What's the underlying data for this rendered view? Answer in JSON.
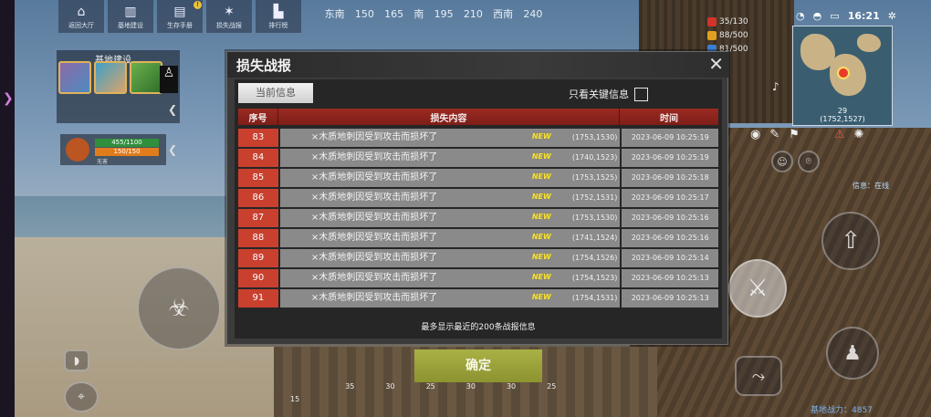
{
  "top_menu": [
    {
      "label": "返回大厅",
      "icon": "home-icon"
    },
    {
      "label": "基地建设",
      "icon": "building-icon"
    },
    {
      "label": "生存手册",
      "icon": "book-icon",
      "badge": "!"
    },
    {
      "label": "损失战报",
      "icon": "battle-icon"
    },
    {
      "label": "排行榜",
      "icon": "ranking-icon"
    }
  ],
  "compass": [
    "东南",
    "150",
    "165",
    "南",
    "195",
    "210",
    "西南",
    "240"
  ],
  "stats": [
    {
      "value": "35/130",
      "color": "#d2332a"
    },
    {
      "value": "88/500",
      "color": "#e0a020"
    },
    {
      "value": "81/500",
      "color": "#3a7fd0"
    }
  ],
  "clock": {
    "time": "16:21"
  },
  "minimap": {
    "marker_id": "29",
    "coord": "(1752,1527)"
  },
  "base_panel": {
    "title": "基地建设"
  },
  "hp_panel": {
    "bar1": "455/1100",
    "bar2": "150/150",
    "label": "无害"
  },
  "dialog": {
    "title": "损失战报",
    "tab_current": "当前信息",
    "key_filter_label": "只看关键信息",
    "columns": [
      "序号",
      "损失内容",
      "时间"
    ],
    "rows": [
      {
        "no": "83",
        "content": "×木质地刺因受到攻击而损坏了",
        "tag": "NEW",
        "coord": "(1753,1530)",
        "time": "2023-06-09 10:25:19"
      },
      {
        "no": "84",
        "content": "×木质地刺因受到攻击而损坏了",
        "tag": "NEW",
        "coord": "(1740,1523)",
        "time": "2023-06-09 10:25:19"
      },
      {
        "no": "85",
        "content": "×木质地刺因受到攻击而损坏了",
        "tag": "NEW",
        "coord": "(1753,1525)",
        "time": "2023-06-09 10:25:18"
      },
      {
        "no": "86",
        "content": "×木质地刺因受到攻击而损坏了",
        "tag": "NEW",
        "coord": "(1752,1531)",
        "time": "2023-06-09 10:25:17"
      },
      {
        "no": "87",
        "content": "×木质地刺因受到攻击而损坏了",
        "tag": "NEW",
        "coord": "(1753,1530)",
        "time": "2023-06-09 10:25:16"
      },
      {
        "no": "88",
        "content": "×木质地刺因受到攻击而损坏了",
        "tag": "NEW",
        "coord": "(1741,1524)",
        "time": "2023-06-09 10:25:16"
      },
      {
        "no": "89",
        "content": "×木质地刺因受到攻击而损坏了",
        "tag": "NEW",
        "coord": "(1754,1526)",
        "time": "2023-06-09 10:25:14"
      },
      {
        "no": "90",
        "content": "×木质地刺因受到攻击而损坏了",
        "tag": "NEW",
        "coord": "(1754,1523)",
        "time": "2023-06-09 10:25:13"
      },
      {
        "no": "91",
        "content": "×木质地刺因受到攻击而损坏了",
        "tag": "NEW",
        "coord": "(1754,1531)",
        "time": "2023-06-09 10:25:13"
      }
    ],
    "footer_note": "最多显示最近的200条战报信息",
    "confirm_label": "确定"
  },
  "bottom_bar": {
    "level": "15",
    "ticks": [
      "35",
      "30",
      "25",
      "30",
      "30",
      "25"
    ]
  },
  "power_text": "基地战力：4857",
  "online_text": "信息：在线"
}
